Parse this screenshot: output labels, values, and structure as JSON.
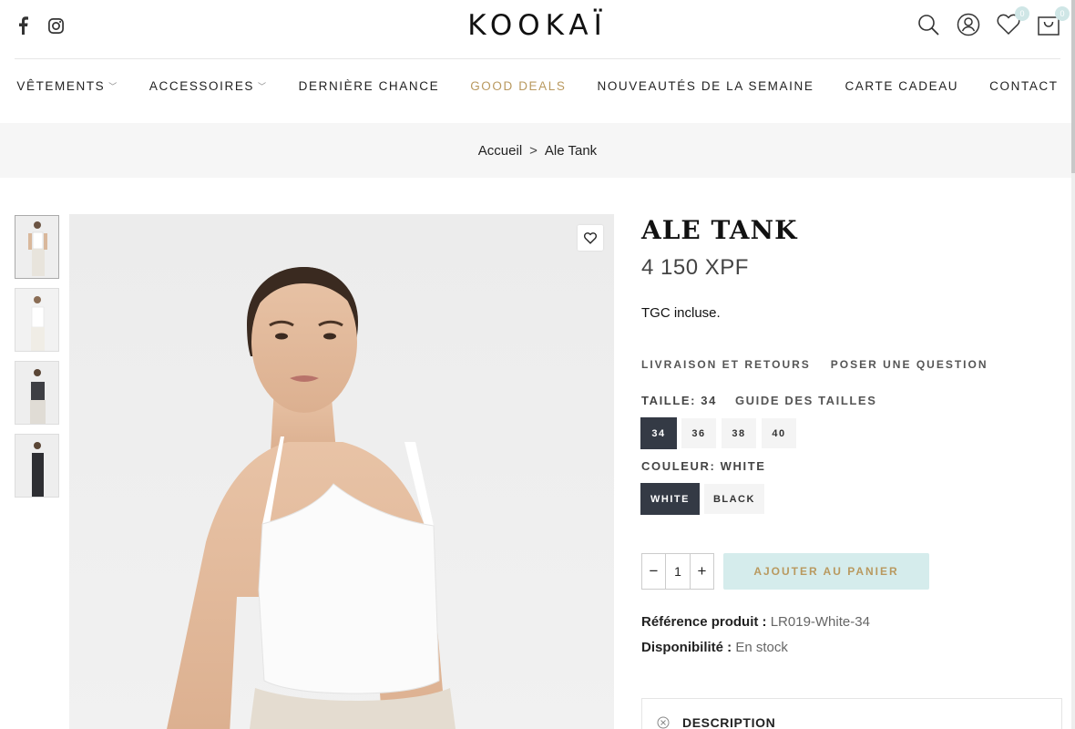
{
  "header": {
    "logo": "KOOKAÏ",
    "social": [
      {
        "icon": "facebook-icon"
      },
      {
        "icon": "instagram-icon"
      }
    ],
    "wishlist_count": "0",
    "cart_count": "0"
  },
  "nav": {
    "items": [
      {
        "label": "VÊTEMENTS",
        "dropdown": true
      },
      {
        "label": "ACCESSOIRES",
        "dropdown": true
      },
      {
        "label": "DERNIÈRE CHANCE",
        "dropdown": false
      },
      {
        "label": "GOOD DEALS",
        "dropdown": false,
        "highlight": true
      },
      {
        "label": "NOUVEAUTÉS DE LA SEMAINE",
        "dropdown": false
      },
      {
        "label": "CARTE CADEAU",
        "dropdown": false
      },
      {
        "label": "CONTACT",
        "dropdown": false
      }
    ]
  },
  "breadcrumb": {
    "home": "Accueil",
    "separator": ">",
    "current": "Ale Tank"
  },
  "product": {
    "title": "ALE TANK",
    "price": "4 150 XPF",
    "tax_note": "TGC incluse.",
    "links": [
      "LIVRAISON ET RETOURS",
      "POSER UNE QUESTION"
    ],
    "size_label": "TAILLE:",
    "size_selected": "34",
    "size_guide": "GUIDE DES TAILLES",
    "sizes": [
      "34",
      "36",
      "38",
      "40"
    ],
    "color_label": "COULEUR:",
    "color_selected": "WHITE",
    "colors": [
      "WHITE",
      "BLACK"
    ],
    "quantity": "1",
    "qty_minus": "−",
    "qty_plus": "+",
    "add_to_cart": "AJOUTER AU PANIER",
    "ref_label": "Référence produit :",
    "ref_value": "LR019-White-34",
    "avail_label": "Disponibilité :",
    "avail_value": "En stock",
    "description_label": "DESCRIPTION"
  },
  "colors": {
    "accent_gold": "#b9995f",
    "selected_dark": "#343a45",
    "add_btn_bg": "#d5ecec",
    "badge_bg": "#cfe6e6"
  }
}
